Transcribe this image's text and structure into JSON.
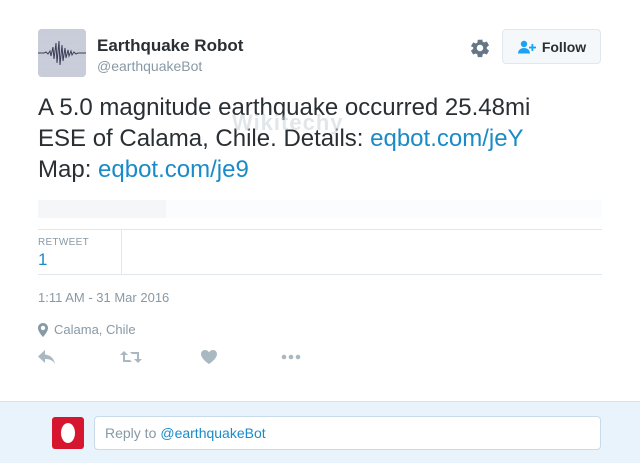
{
  "profile": {
    "name": "Earthquake Robot",
    "handle": "@earthquakeBot",
    "avatar_icon": "seismograph-icon"
  },
  "header": {
    "settings_icon": "gear-icon",
    "follow_label": "Follow",
    "follow_icon": "add-user-icon"
  },
  "tweet": {
    "text_line1": "A 5.0 magnitude earthquake occurred 25.48mi",
    "text_line2_prefix": "ESE of Calama, Chile. Details: ",
    "link_details": "eqbot.com/jeY",
    "text_line3_prefix": "Map: ",
    "link_map": "eqbot.com/je9"
  },
  "watermark": "Wikitechy",
  "stats": {
    "retweet_label": "RETWEET",
    "retweet_count": "1"
  },
  "timestamp": "1:11 AM - 31 Mar 2016",
  "location": {
    "icon": "location-pin-icon",
    "text": "Calama, Chile"
  },
  "actions": {
    "reply_icon": "reply-icon",
    "retweet_icon": "retweet-icon",
    "like_icon": "heart-icon",
    "more_icon": "more-icon"
  },
  "reply": {
    "prefix": "Reply to",
    "mention": "@earthquakeBot"
  },
  "colors": {
    "link": "#1a8bc8",
    "muted": "#8899a6",
    "reply_bar": "#e9f3fb",
    "reply_avatar": "#d6162e"
  }
}
